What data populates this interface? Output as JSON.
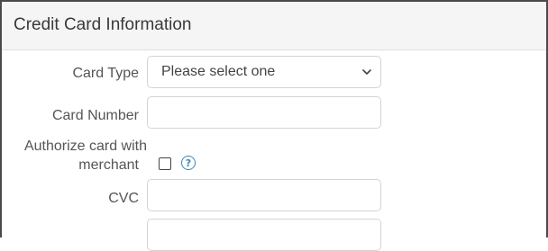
{
  "panel": {
    "title": "Credit Card Information"
  },
  "form": {
    "card_type": {
      "label": "Card Type",
      "selected": "Please select one"
    },
    "card_number": {
      "label": "Card Number",
      "value": ""
    },
    "authorize": {
      "label_line1": "Authorize card with",
      "label_line2": "merchant",
      "checked": false,
      "help_glyph": "?"
    },
    "cvc": {
      "label": "CVC",
      "value": ""
    }
  },
  "icons": {
    "dropdown": "chevron-down-icon",
    "help": "help-icon"
  },
  "colors": {
    "border": "#4a4a4a",
    "header_bg": "#f5f5f5",
    "help_icon": "#3a86b8"
  }
}
